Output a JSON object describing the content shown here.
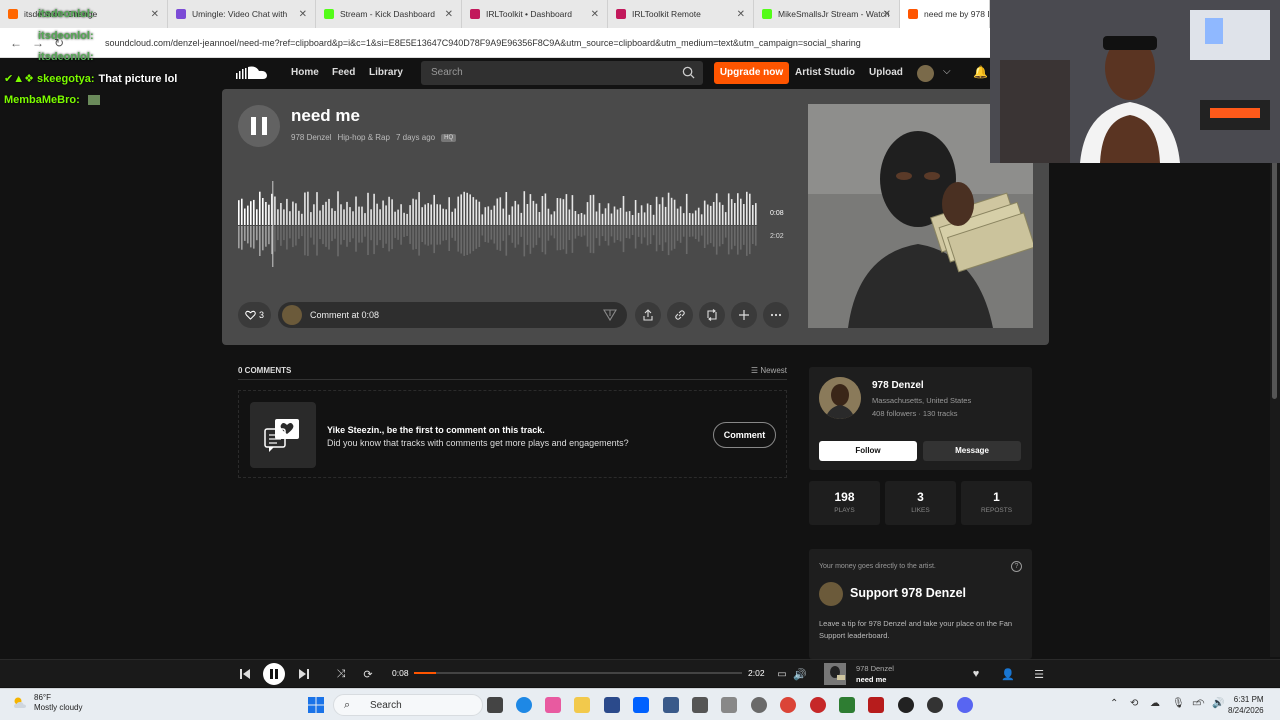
{
  "browser": {
    "tabs": [
      {
        "label": "itsdeonlol - Change",
        "color": "#ff6600",
        "active": false
      },
      {
        "label": "Umingle: Video Chat with",
        "color": "#7b4bd6",
        "active": false
      },
      {
        "label": "Stream - Kick Dashboard",
        "color": "#53fc18",
        "active": false
      },
      {
        "label": "IRLToolkit • Dashboard",
        "color": "#c2185b",
        "active": false
      },
      {
        "label": "IRLToolkit Remote",
        "color": "#c2185b",
        "active": false
      },
      {
        "label": "MikeSmallsJr Stream - Watch",
        "color": "#53fc18",
        "active": false
      },
      {
        "label": "need me by 978 De",
        "color": "#ff5500",
        "active": true
      }
    ],
    "url": "soundcloud.com/denzel-jeannoel/need-me?ref=clipboard&p=i&c=1&si=E8E5E13647C940D78F9A9E96356F8C9A&utm_source=clipboard&utm_medium=text&utm_campaign=social_sharing"
  },
  "chat": [
    {
      "user": "itsdeonlol:",
      "message": "",
      "faded": true
    },
    {
      "user": "itsdeonlol:",
      "message": "",
      "faded": true
    },
    {
      "user": "itsdeonlol:",
      "message": "",
      "faded": true
    },
    {
      "user": "skeegotya:",
      "message": "That picture lol",
      "faded": false
    },
    {
      "user": "MembaMeBro:",
      "message": "",
      "faded": false
    }
  ],
  "header": {
    "nav": [
      "Home",
      "Feed",
      "Library"
    ],
    "search_placeholder": "Search",
    "upgrade_label": "Upgrade now",
    "artist_studio": "Artist Studio",
    "upload": "Upload"
  },
  "track": {
    "title": "need me",
    "artist": "978 Denzel",
    "genre": "Hip-hop & Rap",
    "posted": "7 days ago",
    "quality": "HQ",
    "current_time": "0:08",
    "duration": "2:02",
    "progress": 0.066,
    "likes_count": "3",
    "comment_placeholder": "Comment at 0:08"
  },
  "comments": {
    "count_label": "0 COMMENTS",
    "sort_label": "Newest",
    "empty_line1": "Yike Steezin., be the first to comment on this track.",
    "empty_line2": "Did you know that tracks with comments get more plays and engagements?",
    "comment_button": "Comment"
  },
  "artist": {
    "name": "978 Denzel",
    "location": "Massachusetts, United States",
    "stats": "408 followers · 130 tracks",
    "follow_label": "Follow",
    "message_label": "Message"
  },
  "stats": [
    {
      "value": "198",
      "label": "PLAYS"
    },
    {
      "value": "3",
      "label": "LIKES"
    },
    {
      "value": "1",
      "label": "REPOSTS"
    }
  ],
  "support": {
    "note": "Your money goes directly to the artist.",
    "title": "Support 978 Denzel",
    "description": "Leave a tip for 978 Denzel and take your place on the Fan Support leaderboard."
  },
  "player": {
    "current_time": "0:08",
    "duration": "2:02",
    "artist": "978 Denzel",
    "track": "need me"
  },
  "taskbar": {
    "temperature": "86°F",
    "weather": "Mostly cloudy",
    "search_label": "Search",
    "time": "6:31 PM",
    "date": "8/24/2026"
  },
  "colors": {
    "accent": "#ff5500",
    "chat_user": "#7CFC00",
    "background": "#121212"
  }
}
